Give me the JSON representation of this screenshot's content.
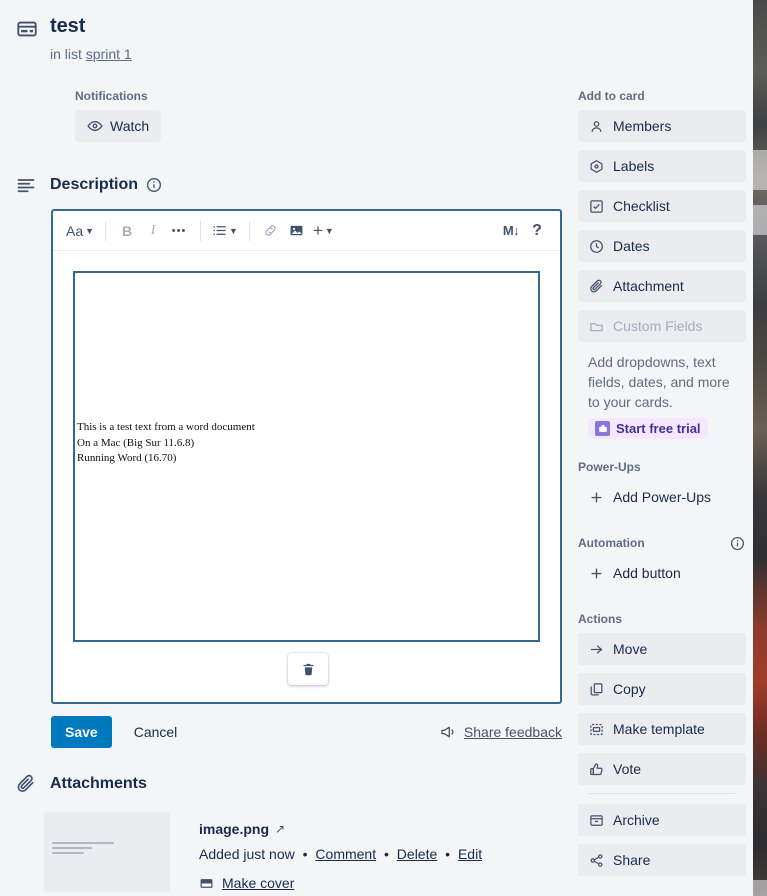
{
  "card": {
    "icon": "card-window-icon",
    "title": "test",
    "in_list_prefix": "in list",
    "list_name": "sprint 1"
  },
  "notifications": {
    "label": "Notifications",
    "watch_label": "Watch",
    "watch_icon": "eye-icon"
  },
  "description": {
    "section_icon": "align-left-icon",
    "title": "Description",
    "info_icon": "info-icon",
    "toolbar": {
      "text_style": "Aa",
      "bold": "B",
      "italic": "I",
      "more": "•••",
      "list": "list-icon",
      "link": "link-icon",
      "image": "image-icon",
      "add": "+",
      "markdown": "M↓",
      "help": "?"
    },
    "embedded_image_text": "This is a test text from a word document\nOn a Mac (Big Sur 11.6.8)\nRunning Word (16.70)",
    "delete_icon": "trash-icon",
    "save_label": "Save",
    "cancel_label": "Cancel",
    "feedback_label": "Share feedback",
    "feedback_icon": "megaphone-icon"
  },
  "attachments": {
    "section_icon": "paperclip-icon",
    "title": "Attachments",
    "items": [
      {
        "name": "image.png",
        "open_icon": "external-link-icon",
        "added": "Added just now",
        "comment_label": "Comment",
        "delete_label": "Delete",
        "edit_label": "Edit",
        "make_cover_label": "Make cover",
        "make_cover_icon": "cover-icon",
        "separator": "•"
      }
    ]
  },
  "sidebar": {
    "add_to_card": {
      "label": "Add to card",
      "items": [
        {
          "label": "Members",
          "icon": "person-icon",
          "disabled": false
        },
        {
          "label": "Labels",
          "icon": "label-icon",
          "disabled": false
        },
        {
          "label": "Checklist",
          "icon": "checkbox-icon",
          "disabled": false
        },
        {
          "label": "Dates",
          "icon": "clock-icon",
          "disabled": false
        },
        {
          "label": "Attachment",
          "icon": "paperclip-icon",
          "disabled": false
        },
        {
          "label": "Custom Fields",
          "icon": "custom-fields-icon",
          "disabled": true
        }
      ],
      "custom_fields_help": "Add dropdowns, text fields, dates, and more to your cards.",
      "trial_label": "Start free trial",
      "trial_icon": "premium-icon"
    },
    "power_ups": {
      "label": "Power-Ups",
      "add_label": "Add Power-Ups",
      "add_icon": "plus-icon"
    },
    "automation": {
      "label": "Automation",
      "info_icon": "info-icon",
      "add_label": "Add button",
      "add_icon": "plus-icon"
    },
    "actions": {
      "label": "Actions",
      "items": [
        {
          "label": "Move",
          "icon": "arrow-right-icon"
        },
        {
          "label": "Copy",
          "icon": "copy-icon"
        },
        {
          "label": "Make template",
          "icon": "template-icon"
        },
        {
          "label": "Vote",
          "icon": "thumbs-up-icon"
        }
      ],
      "items_after_divider": [
        {
          "label": "Archive",
          "icon": "archive-icon"
        },
        {
          "label": "Share",
          "icon": "share-icon"
        }
      ]
    }
  },
  "colors": {
    "surface": "#f4f5f7",
    "accent_blue": "#0079bf",
    "editor_border": "#35688d",
    "button_bg": "#ebecf0",
    "text": "#172b4d",
    "subtle_text": "#5e6c84",
    "trial_bg": "#f6e6ff",
    "trial_text": "#403294"
  }
}
